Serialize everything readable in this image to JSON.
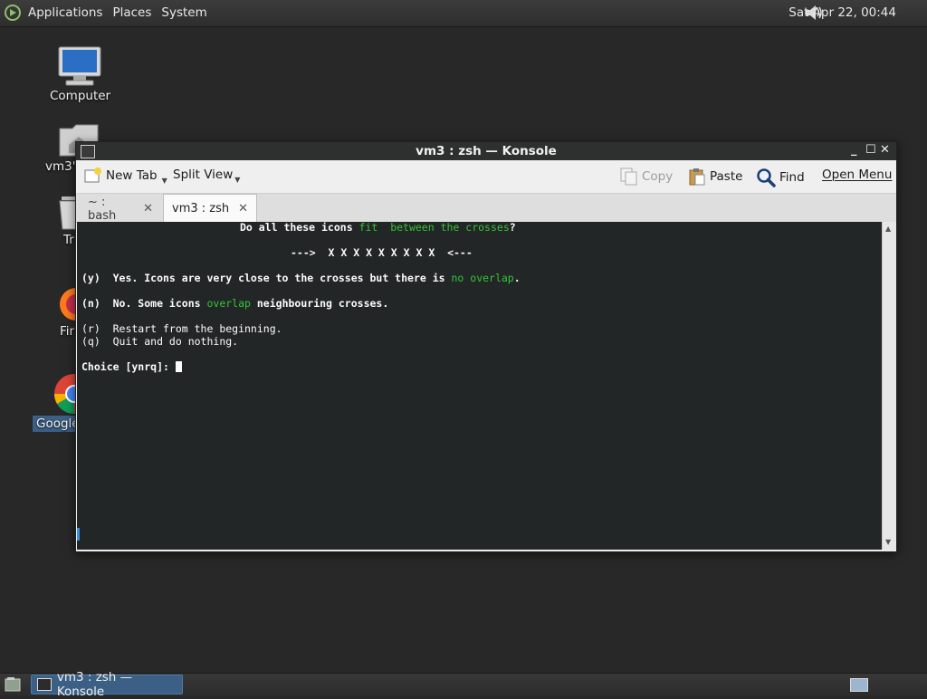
{
  "top_panel": {
    "menus": [
      "Applications",
      "Places",
      "System"
    ],
    "clock": "Sat Apr 22, 00:44"
  },
  "desktop": {
    "icons": [
      {
        "label": "Computer"
      },
      {
        "label": "vm3's"
      },
      {
        "label": "Tr"
      },
      {
        "label": "Fir"
      },
      {
        "label": "Google"
      }
    ]
  },
  "window": {
    "title": "vm3 : zsh — Konsole",
    "toolbar": {
      "new_tab": "New Tab",
      "split_view": "Split View",
      "copy": "Copy",
      "paste": "Paste",
      "find": "Find",
      "open_menu": "Open Menu"
    },
    "tabs": [
      {
        "label": "~ : bash"
      },
      {
        "label": "vm3 : zsh"
      }
    ]
  },
  "terminal": {
    "q_a": "Do all these icons ",
    "q_b": "fit",
    "q_c": "  between the crosses",
    "q_d": "?",
    "crosses": "--->  X X X X X X X X X  <---",
    "y_a": "(y)  Yes. Icons are very close to the crosses but there is ",
    "y_b": "no overlap",
    "y_c": ".",
    "n_a": "(n)  No. Some icons ",
    "n_b": "overlap",
    "n_c": " neighbouring crosses.",
    "r": "(r)  Restart from the beginning.",
    "q": "(q)  Quit and do nothing.",
    "prompt": "Choice [ynrq]: "
  },
  "taskbar": {
    "task_label": "vm3 : zsh — Konsole"
  },
  "icons": {
    "logo": "distro-logo-icon",
    "volume": "volume-icon",
    "new_tab": "new-tab-icon",
    "copy": "copy-icon",
    "paste": "paste-icon",
    "find": "magnifier-icon",
    "close_tab": "close-tab-icon"
  },
  "colors": {
    "terminal_bg": "#232627",
    "terminal_fg": "#fcfcfc",
    "terminal_green": "#33c533",
    "task_active": "#3b5f85"
  }
}
